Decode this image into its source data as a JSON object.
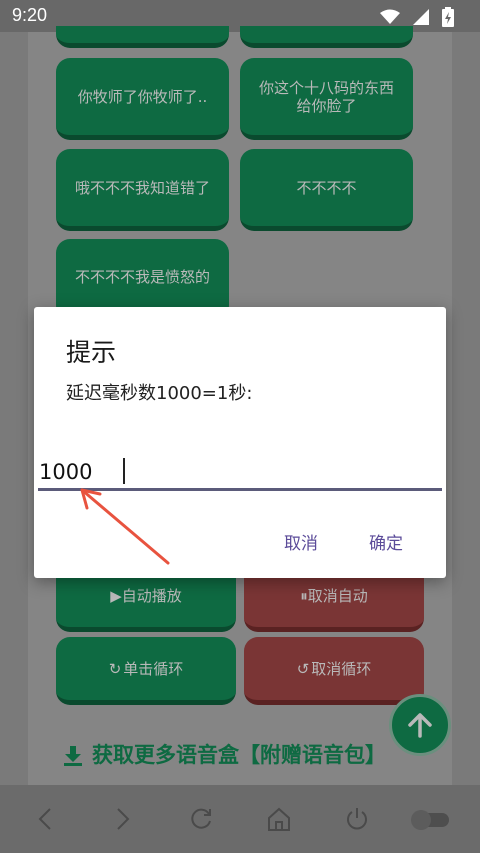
{
  "status_bar": {
    "time": "9:20",
    "icons": [
      "wifi-icon",
      "signal-icon",
      "battery-charging-icon"
    ]
  },
  "voice_buttons": [
    {
      "label": "你牧师了你牧师了.."
    },
    {
      "label": "你这个十八码的东西给你脸了"
    },
    {
      "label": "哦不不不我知道错了"
    },
    {
      "label": "不不不不"
    },
    {
      "label": "不不不不我是愤怒的"
    }
  ],
  "controls": {
    "auto_play": "▶自动播放",
    "cancel_auto": "⏸取消自动",
    "single_loop": "单击循环",
    "cancel_loop": "取消循环"
  },
  "more_link": {
    "text": "获取更多语音盒【附赠语音包】"
  },
  "dialog": {
    "title": "提示",
    "message": "延迟毫秒数1000=1秒:",
    "input_value": "1000",
    "cancel_label": "取消",
    "confirm_label": "确定"
  },
  "colors": {
    "primary_green": "#0e6a42",
    "danger_red": "#7a3535",
    "dialog_button": "#5b4b99",
    "annotation_arrow": "#e8533f"
  },
  "bottom_bar": {
    "items": [
      "back-icon",
      "forward-icon",
      "refresh-icon",
      "home-icon",
      "power-icon",
      "toggle-switch"
    ]
  }
}
